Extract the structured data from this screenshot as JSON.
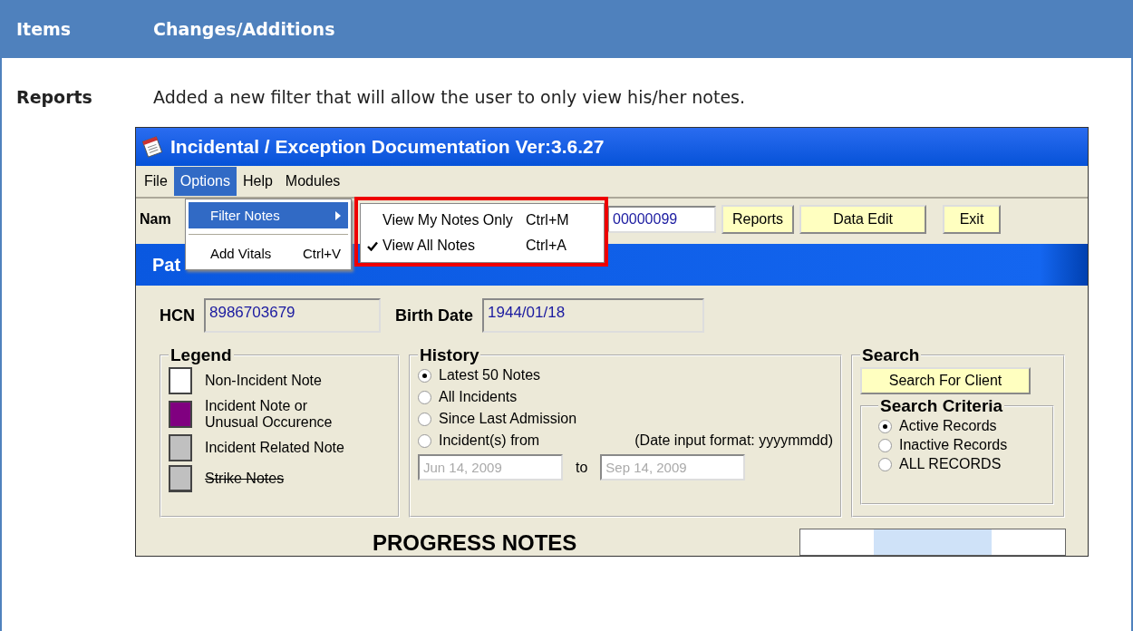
{
  "header": {
    "columns": [
      "Items",
      "Changes/Additions"
    ]
  },
  "row": {
    "item": "Reports",
    "description": "Added a new filter that will allow the user to only view his/her notes."
  },
  "app": {
    "title": "Incidental / Exception Documentation Ver:3.6.27",
    "menu": [
      {
        "label": "File",
        "selected": false
      },
      {
        "label": "Options",
        "selected": true
      },
      {
        "label": "Help",
        "selected": false
      },
      {
        "label": "Modules",
        "selected": false
      }
    ],
    "toolbar": {
      "name_label": "Nam",
      "name_value": "00000099",
      "buttons": [
        "Reports",
        "Data Edit",
        "Exit"
      ]
    },
    "child_title": "Pat",
    "hcn": {
      "label": "HCN",
      "value": "8986703679"
    },
    "birth_date": {
      "label": "Birth Date",
      "value": "1944/01/18"
    },
    "legend": {
      "title": "Legend",
      "items": [
        {
          "label": "Non-Incident Note",
          "color": "#ffffff",
          "kind": "plain"
        },
        {
          "label": "Incident Note or Unusual Occurence",
          "color": "#800080",
          "kind": "plain"
        },
        {
          "label": "Incident Related Note",
          "color": "#c0c0c0",
          "kind": "plain"
        },
        {
          "label": "Strike Notes",
          "color": "#c0c0c0",
          "kind": "strike"
        }
      ]
    },
    "history": {
      "title": "History",
      "options": [
        {
          "label": "Latest 50 Notes",
          "selected": true
        },
        {
          "label": "All Incidents",
          "selected": false
        },
        {
          "label": "Since Last Admission",
          "selected": false
        },
        {
          "label": "Incident(s) from",
          "selected": false
        }
      ],
      "format_hint": "(Date input format: yyyymmdd)",
      "from": "Jun 14, 2009",
      "to_label": "to",
      "to": "Sep 14, 2009"
    },
    "search": {
      "title": "Search",
      "button": "Search For Client",
      "criteria_title": "Search Criteria",
      "options": [
        {
          "label": "Active Records",
          "selected": true
        },
        {
          "label": "Inactive Records",
          "selected": false
        },
        {
          "label": "ALL RECORDS",
          "selected": false
        }
      ]
    },
    "progress_title": "PROGRESS NOTES",
    "options_menu": [
      {
        "kind": "submenu",
        "label": "Filter Notes",
        "selected": true
      },
      {
        "kind": "separator"
      },
      {
        "kind": "item",
        "label": "Add Vitals",
        "shortcut": "Ctrl+V",
        "selected": false
      }
    ],
    "filter_submenu": [
      {
        "label": "View My Notes Only",
        "shortcut": "Ctrl+M",
        "checked": false
      },
      {
        "label": "View All Notes",
        "shortcut": "Ctrl+A",
        "checked": true
      }
    ]
  }
}
